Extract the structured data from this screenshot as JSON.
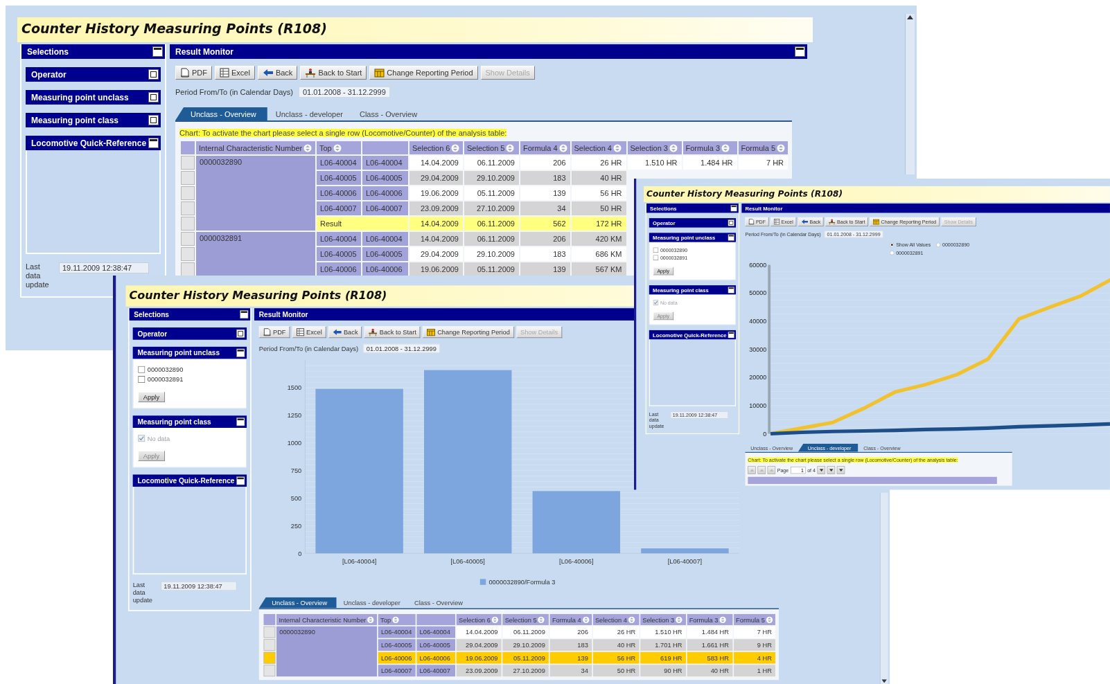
{
  "background_window": {
    "title": "Counter History Measuring Points (R108)",
    "selections": {
      "title": "Selections",
      "expanded": true,
      "sections": [
        {
          "title": "Operator",
          "expanded": false
        },
        {
          "title": "Measuring point unclass",
          "expanded": false
        },
        {
          "title": "Measuring point class",
          "expanded": false
        },
        {
          "title": "Locomotive Quick-Reference",
          "expanded": true
        }
      ]
    },
    "last_update": {
      "label": "Last data update",
      "value": "19.11.2009 12:38:47"
    },
    "result_monitor": {
      "title": "Result Monitor",
      "expanded": true,
      "toolbar": [
        {
          "kind": "pdf",
          "label": "PDF",
          "disabled": false
        },
        {
          "kind": "excel",
          "label": "Excel",
          "disabled": false
        },
        {
          "kind": "back",
          "label": "Back",
          "disabled": false
        },
        {
          "kind": "start",
          "label": "Back to Start",
          "disabled": false
        },
        {
          "kind": "period",
          "label": "Change Reporting Period",
          "disabled": false
        },
        {
          "kind": "plain",
          "label": "Show Details",
          "disabled": true
        }
      ],
      "period": {
        "label": "Period From/To (in Calendar Days)",
        "value": "01.01.2008 - 31.12.2999"
      },
      "tabs": [
        {
          "label": "Unclass - Overview",
          "selected": true
        },
        {
          "label": "Unclass - developer",
          "selected": false
        },
        {
          "label": "Class - Overview",
          "selected": false
        }
      ],
      "hint": "Chart: To activate the chart please select a single row (Locomotive/Counter) of the analysis table:",
      "table": {
        "columns": [
          {
            "label": "Internal Characteristic Number",
            "sortable": true
          },
          {
            "label": "Top",
            "sortable": true
          },
          {
            "sortable": false
          },
          {
            "label": "Selection 6",
            "sortable": true
          },
          {
            "label": "Selection 5",
            "sortable": true
          },
          {
            "label": "Formula 4",
            "sortable": true
          },
          {
            "label": "Selection 4",
            "sortable": true
          },
          {
            "label": "Selection 3",
            "sortable": true
          },
          {
            "label": "Formula 3",
            "sortable": true
          },
          {
            "label": "Formula 5",
            "sortable": true
          }
        ],
        "groups": [
          {
            "key": "0000032890",
            "rows": [
              {
                "kind": "item",
                "cells": [
                  "L06-40004",
                  "L06-40004",
                  "14.04.2009",
                  "06.11.2009",
                  "206",
                  "26 HR",
                  "1.510 HR",
                  "1.484 HR",
                  "7 HR"
                ]
              },
              {
                "kind": "item",
                "cells": [
                  "L06-40005",
                  "L06-40005",
                  "29.04.2009",
                  "29.10.2009",
                  "183",
                  "40 HR"
                ]
              },
              {
                "kind": "item",
                "cells": [
                  "L06-40006",
                  "L06-40006",
                  "19.06.2009",
                  "05.11.2009",
                  "139",
                  "56 HR"
                ]
              },
              {
                "kind": "item",
                "cells": [
                  "L06-40007",
                  "L06-40007",
                  "23.09.2009",
                  "27.10.2009",
                  "34",
                  "50 HR"
                ]
              },
              {
                "kind": "result",
                "cells": [
                  {
                    "text": "Result",
                    "colspan": 2
                  },
                  "14.04.2009",
                  "06.11.2009",
                  "562",
                  "172 HR"
                ]
              }
            ]
          },
          {
            "key": "0000032891",
            "rows": [
              {
                "kind": "item",
                "cells": [
                  "L06-40004",
                  "L06-40004",
                  "14.04.2009",
                  "06.11.2009",
                  "206",
                  "420 KM"
                ]
              },
              {
                "kind": "item",
                "cells": [
                  "L06-40005",
                  "L06-40005",
                  "29.04.2009",
                  "29.10.2009",
                  "183",
                  "686 KM"
                ]
              },
              {
                "kind": "item",
                "cells": [
                  "L06-40006",
                  "L06-40006",
                  "19.06.2009",
                  "05.11.2009",
                  "139",
                  "567 KM"
                ]
              }
            ]
          }
        ]
      }
    }
  },
  "right_window": {
    "title": "Counter History Measuring Points (R108)",
    "selections": {
      "title": "Selections",
      "expanded": true,
      "sections": [
        {
          "title": "Operator",
          "expanded": false
        },
        {
          "title": "Measuring point unclass",
          "expanded": true,
          "items": [
            {
              "label": "0000032890",
              "checked": false,
              "disabled": false
            },
            {
              "label": "0000032891",
              "checked": false,
              "disabled": false
            }
          ],
          "apply": {
            "label": "Apply",
            "disabled": false
          }
        },
        {
          "title": "Measuring point class",
          "expanded": true,
          "items": [
            {
              "label": "No data",
              "checked": true,
              "disabled": true
            }
          ],
          "apply": {
            "label": "Apply",
            "disabled": true
          }
        },
        {
          "title": "Locomotive Quick-Reference",
          "expanded": true
        }
      ]
    },
    "last_update": {
      "label": "Last data update",
      "value": "19.11.2009 12:38:47"
    },
    "result_monitor": {
      "title": "Result Monitor",
      "toolbar": [
        {
          "kind": "pdf",
          "label": "PDF",
          "disabled": false
        },
        {
          "kind": "excel",
          "label": "Excel",
          "disabled": false
        },
        {
          "kind": "back",
          "label": "Back",
          "disabled": false
        },
        {
          "kind": "start",
          "label": "Back to Start",
          "disabled": false
        },
        {
          "kind": "period",
          "label": "Change Reporting Period",
          "disabled": false
        },
        {
          "kind": "plain",
          "label": "Show Details",
          "disabled": true
        }
      ],
      "period": {
        "label": "Period From/To (in Calendar Days)",
        "value": "01.01.2008 - 31.12.2999"
      },
      "options": [
        {
          "label": "Show All Values",
          "selected": true
        },
        {
          "label": "0000032890",
          "selected": false
        },
        {
          "label": "0000032891",
          "selected": false
        }
      ],
      "chart_data": {
        "type": "line",
        "grid": true,
        "ylim": [
          0,
          60000
        ],
        "yticks": [
          0,
          10000,
          20000,
          30000,
          40000,
          50000,
          60000
        ],
        "series": [
          {
            "color": "#f2c12e",
            "values": [
              0,
              2000,
              4000,
              9000,
              14800,
              17500,
              21000,
              26500,
              40800,
              45000,
              49000,
              55000
            ]
          },
          {
            "color": "#1c4f8a",
            "values": [
              0,
              500,
              800,
              1000,
              1200,
              1500,
              1700,
              2000,
              2500,
              2800,
              3100,
              3500
            ]
          }
        ]
      },
      "tabs": [
        {
          "label": "Unclass - Overview",
          "selected": false
        },
        {
          "label": "Unclass - developer",
          "selected": true
        },
        {
          "label": "Class - Overview",
          "selected": false
        }
      ],
      "hint": "Chart: To activate the chart please select a single row (Locomotive/Counter) of the analysis table:",
      "pager": {
        "label": "Page",
        "value": "1",
        "total": "of 4"
      }
    }
  },
  "front_window": {
    "title": "Counter History Measuring Points (R108)",
    "selections": {
      "title": "Selections",
      "expanded": true,
      "sections": [
        {
          "title": "Operator",
          "expanded": false
        },
        {
          "title": "Measuring point unclass",
          "expanded": true,
          "items": [
            {
              "label": "0000032890",
              "checked": false,
              "disabled": false
            },
            {
              "label": "0000032891",
              "checked": false,
              "disabled": false
            }
          ],
          "apply": {
            "label": "Apply",
            "disabled": false
          }
        },
        {
          "title": "Measuring point class",
          "expanded": true,
          "items": [
            {
              "label": "No data",
              "checked": true,
              "disabled": true
            }
          ],
          "apply": {
            "label": "Apply",
            "disabled": true
          }
        },
        {
          "title": "Locomotive Quick-Reference",
          "expanded": true
        }
      ]
    },
    "last_update": {
      "label": "Last data update",
      "value": "19.11.2009 12:38:47"
    },
    "result_monitor": {
      "title": "Result Monitor",
      "toolbar": [
        {
          "kind": "pdf",
          "label": "PDF",
          "disabled": false
        },
        {
          "kind": "excel",
          "label": "Excel",
          "disabled": false
        },
        {
          "kind": "back",
          "label": "Back",
          "disabled": false
        },
        {
          "kind": "start",
          "label": "Back to Start",
          "disabled": false
        },
        {
          "kind": "period",
          "label": "Change Reporting Period",
          "disabled": false
        },
        {
          "kind": "plain",
          "label": "Show Details",
          "disabled": true
        }
      ],
      "period": {
        "label": "Period From/To (in Calendar Days)",
        "value": "01.01.2008 - 31.12.2999"
      },
      "chart_data": {
        "type": "bar",
        "grid": true,
        "categories": [
          "[L06-40004]",
          "[L06-40005]",
          "[L06-40006]",
          "[L06-40007]"
        ],
        "ylim": [
          0,
          1750
        ],
        "yticks": [
          0,
          250,
          500,
          750,
          1000,
          1250,
          1500
        ],
        "series": [
          {
            "name": "0000032890/Formula 3",
            "color": "#7da6de",
            "values": [
              1490,
              1660,
              564,
              45
            ]
          }
        ]
      },
      "tabs": [
        {
          "label": "Unclass - Overview",
          "selected": true
        },
        {
          "label": "Unclass - developer",
          "selected": false
        },
        {
          "label": "Class - Overview",
          "selected": false
        }
      ],
      "table": {
        "columns": [
          {
            "label": "Internal Characteristic Number",
            "sortable": true
          },
          {
            "label": "Top",
            "sortable": true
          },
          {
            "sortable": false
          },
          {
            "label": "Selection 6",
            "sortable": true
          },
          {
            "label": "Selection 5",
            "sortable": true
          },
          {
            "label": "Formula 4",
            "sortable": true
          },
          {
            "label": "Selection 4",
            "sortable": true
          },
          {
            "label": "Selection 3",
            "sortable": true
          },
          {
            "label": "Formula 3",
            "sortable": true
          },
          {
            "label": "Formula 5",
            "sortable": true
          }
        ],
        "groups": [
          {
            "key": "0000032890",
            "rows": [
              {
                "kind": "item",
                "selected": false,
                "cells": [
                  "L06-40004",
                  "L06-40004",
                  "14.04.2009",
                  "06.11.2009",
                  "206",
                  "26 HR",
                  "1.510 HR",
                  "1.484 HR",
                  "7 HR"
                ]
              },
              {
                "kind": "item",
                "selected": false,
                "cells": [
                  "L06-40005",
                  "L06-40005",
                  "29.04.2009",
                  "29.10.2009",
                  "183",
                  "40 HR",
                  "1.701 HR",
                  "1.661 HR",
                  "9 HR"
                ]
              },
              {
                "kind": "item",
                "selected": true,
                "cells": [
                  "L06-40006",
                  "L06-40006",
                  "19.06.2009",
                  "05.11.2009",
                  "139",
                  "56 HR",
                  "619 HR",
                  "583 HR",
                  "4 HR"
                ]
              },
              {
                "kind": "item",
                "selected": false,
                "cells": [
                  "L06-40007",
                  "L06-40007",
                  "23.09.2009",
                  "27.10.2009",
                  "34",
                  "50 HR",
                  "90 HR",
                  "40 HR",
                  "1 HR"
                ]
              }
            ]
          }
        ]
      }
    }
  }
}
